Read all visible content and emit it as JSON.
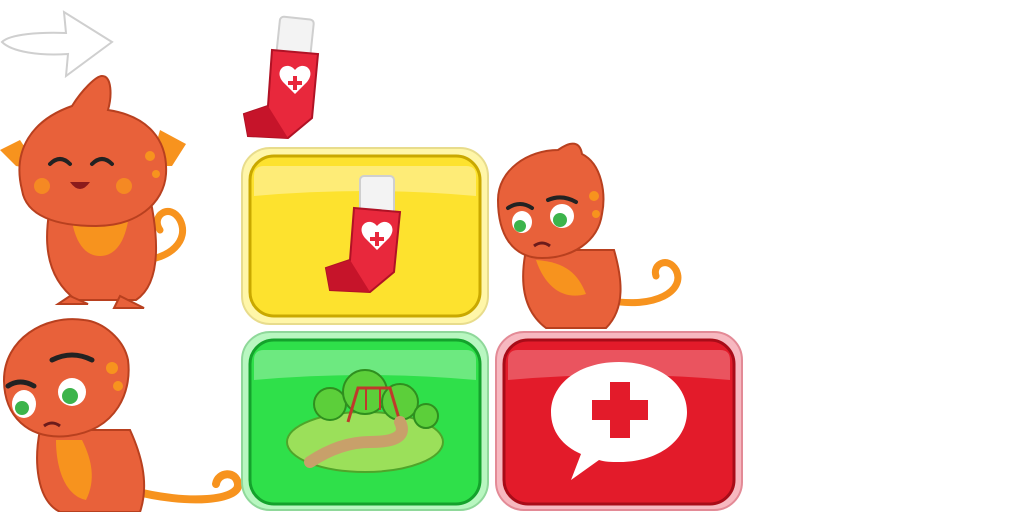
{
  "sprites": {
    "arrow": {
      "icon": "arrow-right-icon",
      "stroke": "#cccccc",
      "fill": "#ffffff"
    },
    "inhaler": {
      "icon": "inhaler-icon",
      "body": "#e8283c",
      "cap": "#f4f4f4",
      "heart": "#ffffff"
    },
    "mascot_happy": {
      "icon": "mascot-happy-icon",
      "skin": "#e8613a",
      "belly": "#f7931e",
      "spots": "#f7931e"
    },
    "mascot_sad": {
      "icon": "mascot-sad-icon",
      "skin": "#e8613a",
      "belly": "#f7931e",
      "eyes": "#3cb44b"
    },
    "mascot_sick": {
      "icon": "mascot-sick-icon",
      "skin": "#e8613a",
      "belly": "#f7931e",
      "eyes": "#3cb44b"
    }
  },
  "buttons": {
    "inhaler": {
      "icon": "inhaler-icon",
      "fill": "#fde22e",
      "rim": "#fff6a8",
      "edge": "#c9a800"
    },
    "park": {
      "icon": "park-playground-icon",
      "fill": "#2fe04a",
      "rim": "#b8f7c0",
      "edge": "#14a22c"
    },
    "help": {
      "icon": "medical-help-bubble-icon",
      "fill": "#e31b2a",
      "rim": "#f7b8c0",
      "edge": "#a80c18"
    }
  }
}
